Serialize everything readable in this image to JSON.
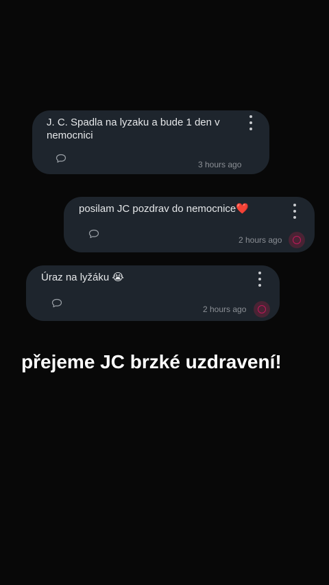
{
  "posts": [
    {
      "text": "J. C. Spadla na lyzaku a bude 1 den v nemocnici",
      "time": "3 hours ago",
      "has_reaction": false
    },
    {
      "text": "posilam JC pozdrav do nemocnice❤️",
      "time": "2 hours ago",
      "has_reaction": true
    },
    {
      "text": "Úraz na lyžáku 😭",
      "time": "2 hours ago",
      "has_reaction": true
    }
  ],
  "caption": "přejeme JC brzké uzdravení!",
  "icons": {
    "menu": "more-vertical-icon",
    "comment": "comment-icon",
    "reaction": "reaction-icon"
  },
  "colors": {
    "background": "#080808",
    "card": "#1e252d",
    "accent": "#c2185b"
  }
}
